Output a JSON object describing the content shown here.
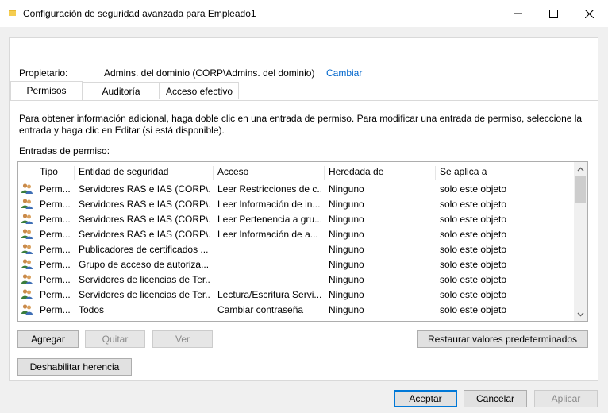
{
  "window": {
    "title": "Configuración de seguridad avanzada para Empleado1"
  },
  "owner": {
    "label": "Propietario:",
    "value": "Admins. del dominio (CORP\\Admins. del dominio)",
    "change_link": "Cambiar"
  },
  "tabs": [
    {
      "label": "Permisos",
      "active": true
    },
    {
      "label": "Auditoría",
      "active": false
    },
    {
      "label": "Acceso efectivo",
      "active": false
    }
  ],
  "info_text": "Para obtener información adicional, haga doble clic en una entrada de permiso. Para modificar una entrada de permiso, seleccione la entrada y haga clic en Editar (si está disponible).",
  "entries_label": "Entradas de permiso:",
  "table": {
    "columns": [
      "Tipo",
      "Entidad de seguridad",
      "Acceso",
      "Heredada de",
      "Se aplica a"
    ],
    "rows": [
      {
        "tipo": "Perm...",
        "entidad": "Servidores RAS e IAS (CORP\\...",
        "acceso": "Leer Restricciones de c...",
        "heredada": "Ninguno",
        "aplica": "solo este objeto"
      },
      {
        "tipo": "Perm...",
        "entidad": "Servidores RAS e IAS (CORP\\...",
        "acceso": "Leer Información de in...",
        "heredada": "Ninguno",
        "aplica": "solo este objeto"
      },
      {
        "tipo": "Perm...",
        "entidad": "Servidores RAS e IAS (CORP\\...",
        "acceso": "Leer Pertenencia a gru...",
        "heredada": "Ninguno",
        "aplica": "solo este objeto"
      },
      {
        "tipo": "Perm...",
        "entidad": "Servidores RAS e IAS (CORP\\...",
        "acceso": "Leer Información de a...",
        "heredada": "Ninguno",
        "aplica": "solo este objeto"
      },
      {
        "tipo": "Perm...",
        "entidad": "Publicadores de certificados ...",
        "acceso": "",
        "heredada": "Ninguno",
        "aplica": "solo este objeto"
      },
      {
        "tipo": "Perm...",
        "entidad": "Grupo de acceso de autoriza...",
        "acceso": "",
        "heredada": "Ninguno",
        "aplica": "solo este objeto"
      },
      {
        "tipo": "Perm...",
        "entidad": "Servidores de licencias de Ter...",
        "acceso": "",
        "heredada": "Ninguno",
        "aplica": "solo este objeto"
      },
      {
        "tipo": "Perm...",
        "entidad": "Servidores de licencias de Ter...",
        "acceso": "Lectura/Escritura Servi...",
        "heredada": "Ninguno",
        "aplica": "solo este objeto"
      },
      {
        "tipo": "Perm...",
        "entidad": "Todos",
        "acceso": "Cambiar contraseña",
        "heredada": "Ninguno",
        "aplica": "solo este objeto"
      }
    ]
  },
  "buttons": {
    "agregar": "Agregar",
    "quitar": "Quitar",
    "ver": "Ver",
    "restaurar": "Restaurar valores predeterminados",
    "deshabilitar": "Deshabilitar herencia",
    "aceptar": "Aceptar",
    "cancelar": "Cancelar",
    "aplicar": "Aplicar"
  },
  "icons": {
    "title": "folder-icon",
    "row": "user-group-icon"
  },
  "colors": {
    "link": "#0066cc",
    "accent": "#0078d7"
  }
}
